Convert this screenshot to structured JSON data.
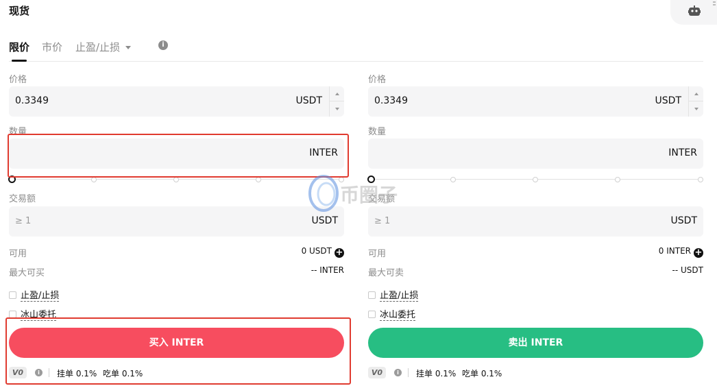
{
  "title": "现货",
  "tabs": [
    {
      "label": "限价",
      "active": true
    },
    {
      "label": "市价",
      "active": false
    },
    {
      "label": "止盈/止损",
      "active": false
    }
  ],
  "buy": {
    "price_label": "价格",
    "price_value": "0.3349",
    "price_unit": "USDT",
    "amount_label": "数量",
    "amount_unit": "INTER",
    "total_label": "交易额",
    "total_placeholder": "≥ 1",
    "total_unit": "USDT",
    "available_label": "可用",
    "available_value": "0 USDT",
    "max_label": "最大可买",
    "max_value": "-- INTER",
    "tpsl_label": "止盈/止损",
    "iceberg_label": "冰山委托",
    "button_label": "买入 INTER",
    "vip_badge": "V0",
    "maker_fee": "挂单 0.1%",
    "taker_fee": "吃单 0.1%"
  },
  "sell": {
    "price_label": "价格",
    "price_value": "0.3349",
    "price_unit": "USDT",
    "amount_label": "数量",
    "amount_unit": "INTER",
    "total_label": "交易额",
    "total_placeholder": "≥ 1",
    "total_unit": "USDT",
    "available_label": "可用",
    "available_value": "0 INTER",
    "max_label": "最大可卖",
    "max_value": "-- USDT",
    "tpsl_label": "止盈/止损",
    "iceberg_label": "冰山委托",
    "button_label": "卖出 INTER",
    "vip_badge": "V0",
    "maker_fee": "挂单 0.1%",
    "taker_fee": "吃单 0.1%"
  },
  "watermark": "币圈子",
  "colors": {
    "buy": "#f74d5f",
    "sell": "#27be83",
    "highlight": "#e03a2f"
  },
  "icons": [
    "robot-icon",
    "info-icon",
    "plus-circle-icon",
    "chevron-down-icon"
  ]
}
